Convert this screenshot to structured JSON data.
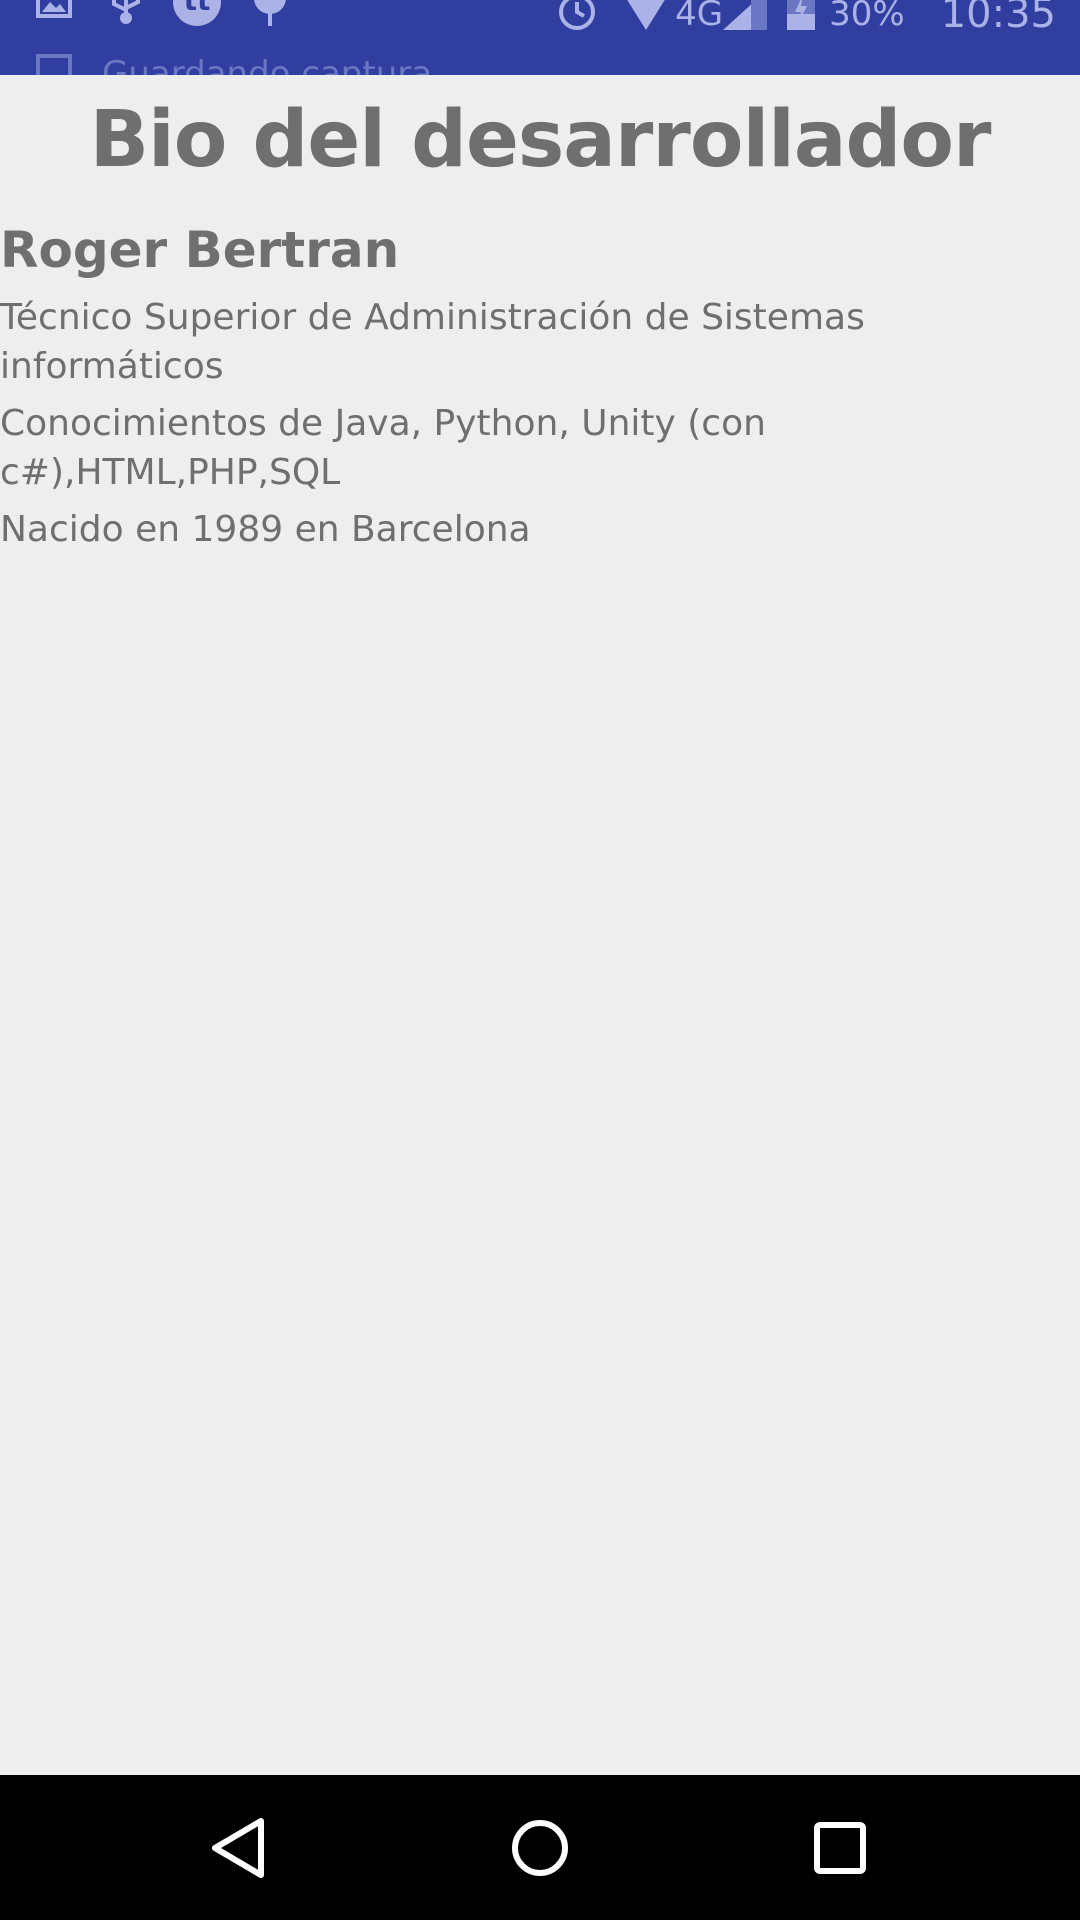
{
  "status_bar": {
    "network": "4G",
    "battery": "30%",
    "time": "10:35",
    "notification": "Guardando captura",
    "icons": [
      "image-icon",
      "usb-icon",
      "app-icon",
      "pin-icon",
      "alarm-icon",
      "wifi-icon",
      "signal-icon",
      "battery-icon"
    ],
    "color": "#303f9f"
  },
  "page": {
    "title": "Bio del desarrollador",
    "name": "Roger Bertran",
    "bio": [
      "Técnico Superior de Administración de Sistemas informáticos",
      "Conocimientos de Java, Python, Unity (con c#),HTML,PHP,SQL",
      "Nacido en 1989 en Barcelona"
    ],
    "text_color": "#6f6f6f",
    "background": "#eeeeee"
  },
  "nav_bar": {
    "buttons": [
      "back-icon",
      "home-icon",
      "recents-icon"
    ]
  }
}
